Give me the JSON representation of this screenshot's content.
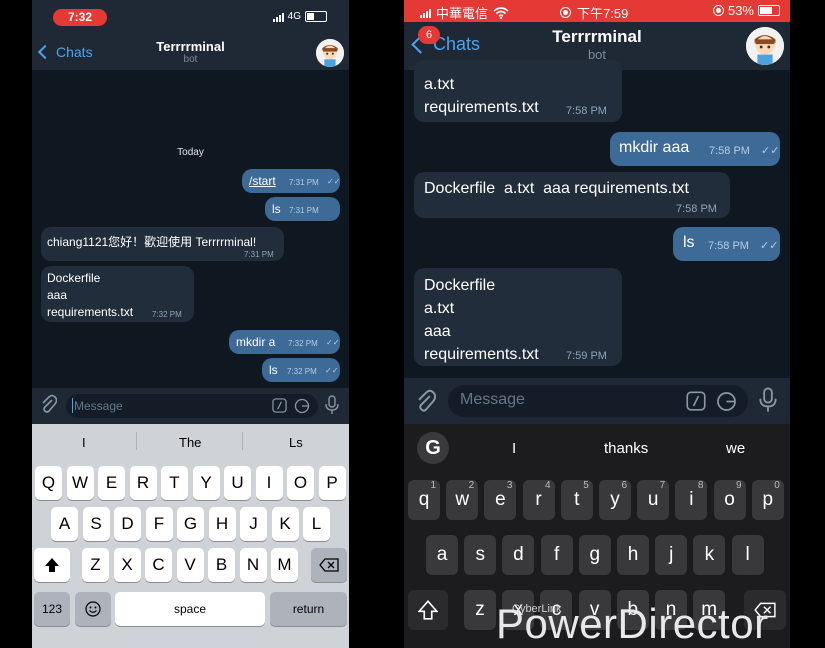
{
  "left": {
    "status": {
      "time": "7:32",
      "network": "4G"
    },
    "nav": {
      "back": "Chats",
      "title": "Terrrrminal",
      "subtitle": "bot"
    },
    "date": "Today",
    "messages": [
      {
        "dir": "out",
        "text": "/start",
        "time": "7:31 PM"
      },
      {
        "dir": "out",
        "text": "ls",
        "time": "7:31 PM"
      },
      {
        "dir": "in",
        "text": "chiang1121您好！歡迎使用 Terrrrminal!",
        "time": "7:31 PM"
      },
      {
        "dir": "in",
        "text": "Dockerfile\naaa\nrequirements.txt",
        "time": "7:32 PM"
      },
      {
        "dir": "out",
        "text": "mkdir a",
        "time": "7:32 PM"
      },
      {
        "dir": "out",
        "text": "ls",
        "time": "7:32 PM"
      }
    ],
    "input": {
      "placeholder": "Message"
    },
    "suggestions": [
      "I",
      "The",
      "Ls"
    ],
    "keys": {
      "row1": [
        "Q",
        "W",
        "E",
        "R",
        "T",
        "Y",
        "U",
        "I",
        "O",
        "P"
      ],
      "row2": [
        "A",
        "S",
        "D",
        "F",
        "G",
        "H",
        "J",
        "K",
        "L"
      ],
      "row3": [
        "Z",
        "X",
        "C",
        "V",
        "B",
        "N",
        "M"
      ],
      "numbers": "123",
      "space": "space",
      "return": "return"
    }
  },
  "right": {
    "status": {
      "carrier": "中華電信",
      "time": "下午7:59",
      "battery": "53%"
    },
    "nav": {
      "back": "Chats",
      "badge": "6",
      "title": "Terrrrminal",
      "subtitle": "bot"
    },
    "messages": [
      {
        "dir": "in",
        "text": "a.txt\nrequirements.txt",
        "time": "7:58 PM"
      },
      {
        "dir": "out",
        "text": "mkdir aaa",
        "time": "7:58 PM"
      },
      {
        "dir": "in",
        "text": "Dockerfile  a.txt  aaa requirements.txt",
        "time": "7:58 PM"
      },
      {
        "dir": "out",
        "text": "ls",
        "time": "7:58 PM"
      },
      {
        "dir": "in",
        "text": "Dockerfile\na.txt\naaa\nrequirements.txt",
        "time": "7:59 PM"
      }
    ],
    "input": {
      "placeholder": "Message"
    },
    "suggestions": [
      "I",
      "thanks",
      "we"
    ],
    "keys": {
      "row1": [
        {
          "k": "q",
          "n": "1"
        },
        {
          "k": "w",
          "n": "2"
        },
        {
          "k": "e",
          "n": "3"
        },
        {
          "k": "r",
          "n": "4"
        },
        {
          "k": "t",
          "n": "5"
        },
        {
          "k": "y",
          "n": "6"
        },
        {
          "k": "u",
          "n": "7"
        },
        {
          "k": "i",
          "n": "8"
        },
        {
          "k": "o",
          "n": "9"
        },
        {
          "k": "p",
          "n": "0"
        }
      ],
      "row2": [
        "a",
        "s",
        "d",
        "f",
        "g",
        "h",
        "j",
        "k",
        "l"
      ],
      "row3": [
        "z",
        "x",
        "c",
        "v",
        "b",
        "n",
        "m"
      ]
    }
  },
  "watermark": {
    "main": "PowerDirector",
    "small": "CyberLink"
  }
}
